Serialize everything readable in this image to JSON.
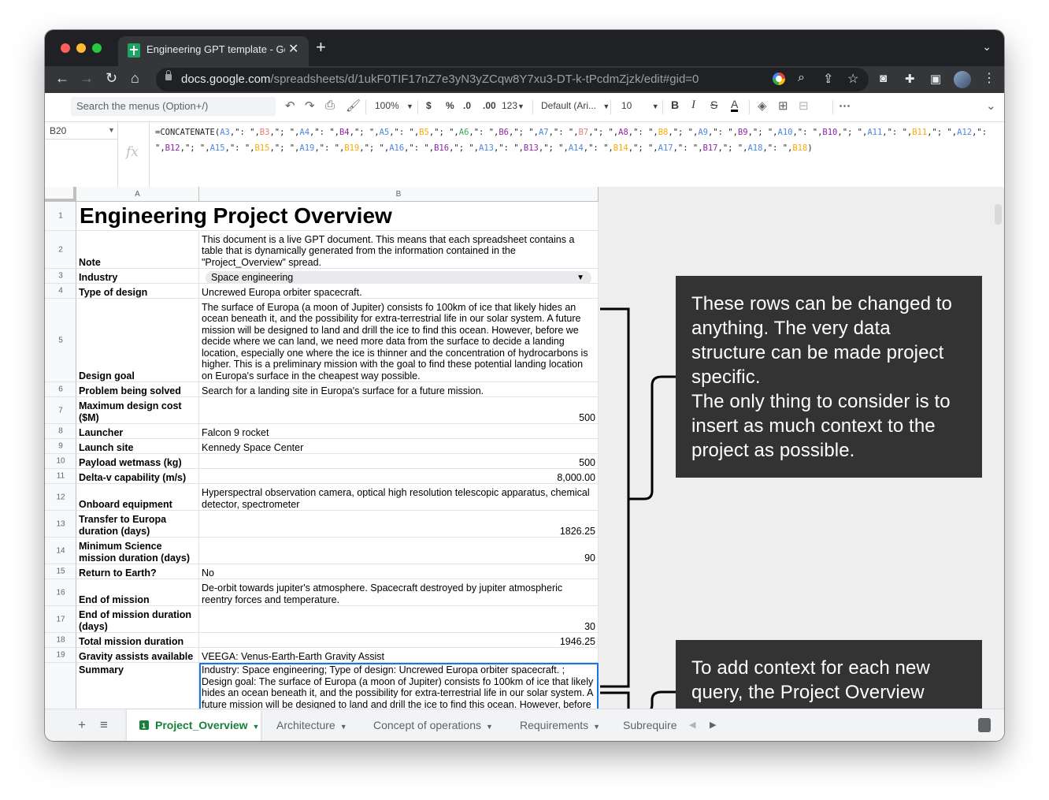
{
  "browser": {
    "tab_title": "Engineering GPT template - Go",
    "url_domain": "docs.google.com",
    "url_path": "/spreadsheets/d/1ukF0TIF17nZ7e3yN3yZCqw8Y7xu3-DT-k-tPcdmZjzk/edit#gid=0",
    "colors": {
      "close": "#ff5f57",
      "minimize": "#febc2e",
      "maximize": "#28c840"
    }
  },
  "sheets_toolbar": {
    "search_placeholder": "Search the menus (Option+/)",
    "zoom": "100%",
    "currency": "$",
    "percent": "%",
    "dec_decrease": ".0",
    "dec_increase": ".00",
    "format_more": "123",
    "font": "Default (Ari...",
    "font_size": "10"
  },
  "formula_bar": {
    "cell_ref": "B20",
    "fx": "fx",
    "segments": [
      [
        "=CONCATENATE(",
        ""
      ],
      [
        "A3",
        "a"
      ],
      [
        ",\": \",",
        ""
      ],
      [
        "B3",
        "b"
      ],
      [
        ",\"; \",",
        ""
      ],
      [
        "A4",
        "a"
      ],
      [
        ",\": \",",
        ""
      ],
      [
        "B4",
        "c"
      ],
      [
        ",\"; \",",
        ""
      ],
      [
        "A5",
        "a"
      ],
      [
        ",\": \",",
        ""
      ],
      [
        "B5",
        "d"
      ],
      [
        ",\"; \",",
        ""
      ],
      [
        "A6",
        "e"
      ],
      [
        ",\": \",",
        ""
      ],
      [
        "B6",
        "c"
      ],
      [
        ",\"; \",",
        ""
      ],
      [
        "A7",
        "a"
      ],
      [
        ",\": \",",
        ""
      ],
      [
        "B7",
        "b"
      ],
      [
        ",\"; \",",
        ""
      ],
      [
        "A8",
        "c"
      ],
      [
        ",\": \",",
        ""
      ],
      [
        "B8",
        "d"
      ],
      [
        ",\"; \",",
        ""
      ],
      [
        "A9",
        "a"
      ],
      [
        ",\": \",",
        ""
      ],
      [
        "B9",
        "c"
      ],
      [
        ",\"; \",",
        ""
      ],
      [
        "A10",
        "a"
      ],
      [
        ",\": \",",
        ""
      ],
      [
        "B10",
        "c"
      ],
      [
        ",\"; \",",
        ""
      ],
      [
        "A11",
        "a"
      ],
      [
        ",\": \",",
        ""
      ],
      [
        "B11",
        "d"
      ],
      [
        ",\"; \",",
        ""
      ],
      [
        "A12",
        "a"
      ],
      [
        ",\": \",",
        ""
      ],
      [
        "B12",
        "c"
      ],
      [
        ",\"; \",",
        ""
      ],
      [
        "A15",
        "a"
      ],
      [
        ",\": \",",
        ""
      ],
      [
        "B15",
        "d"
      ],
      [
        ",\"; \",",
        ""
      ],
      [
        "A19",
        "a"
      ],
      [
        ",\": \",",
        ""
      ],
      [
        "B19",
        "d"
      ],
      [
        ",\"; \",",
        ""
      ],
      [
        "A16",
        "a"
      ],
      [
        ",\": \",",
        ""
      ],
      [
        "B16",
        "c"
      ],
      [
        ",\"; \",",
        ""
      ],
      [
        "A13",
        "a"
      ],
      [
        ",\": \",",
        ""
      ],
      [
        "B13",
        "c"
      ],
      [
        ",\"; \",",
        ""
      ],
      [
        "A14",
        "a"
      ],
      [
        ",\": \",",
        ""
      ],
      [
        "B14",
        "d"
      ],
      [
        ",\"; \",",
        ""
      ],
      [
        "A17",
        "a"
      ],
      [
        ",\": \",",
        ""
      ],
      [
        "B17",
        "c"
      ],
      [
        ",\"; \",",
        ""
      ],
      [
        "A18",
        "a"
      ],
      [
        ",\": \",",
        ""
      ],
      [
        "B18",
        "d"
      ],
      [
        ")",
        ""
      ]
    ]
  },
  "columns": [
    "A",
    "B"
  ],
  "rows": [
    {
      "n": "1",
      "a": "",
      "b": "",
      "title": "Engineering Project Overview",
      "h": 37
    },
    {
      "n": "2",
      "a": "Note",
      "b": "This document is a live GPT document. This means that each spreadsheet contains a table that is dynamically generated from the information contained in the \"Project_Overview\" spread.",
      "h": 48
    },
    {
      "n": "3",
      "a": "Industry",
      "b": "Space engineering",
      "dropdown": true,
      "h": 19
    },
    {
      "n": "4",
      "a": "Type of design",
      "b": "Uncrewed Europa orbiter spacecraft.",
      "h": 19
    },
    {
      "n": "5",
      "a": "Design goal",
      "b": "The surface of Europa (a moon of Jupiter) consists fo 100km of ice that likely hides an ocean beneath it, and the possibility for extra-terrestrial life in our solar system. A future mission will be designed to land and drill the ice to find this ocean. However, before we decide where we can land, we need more data from the surface to decide a landing location, especially one where the ice is thinner and the concentration of hydrocarbons is higher. This is a preliminary mission  with the goal to find these potential landing location on Europa's surface in the cheapest way possible.",
      "h": 106
    },
    {
      "n": "6",
      "a": "Problem being solved",
      "b": "Search for a landing site in Europa's surface for a future mission.",
      "h": 19
    },
    {
      "n": "7",
      "a": "Maximum design cost ($M)",
      "b": "500",
      "num": true,
      "h": 34
    },
    {
      "n": "8",
      "a": "Launcher",
      "b": "Falcon 9 rocket",
      "h": 19
    },
    {
      "n": "9",
      "a": "Launch site",
      "b": "Kennedy Space Center",
      "h": 19
    },
    {
      "n": "10",
      "a": "Payload wetmass (kg)",
      "b": "500",
      "num": true,
      "h": 19
    },
    {
      "n": "11",
      "a": "Delta-v capability (m/s)",
      "b": "8,000.00",
      "num": true,
      "h": 19
    },
    {
      "n": "12",
      "a": "Onboard equipment",
      "b": "Hyperspectral observation camera, optical high resolution telescopic apparatus, chemical detector, spectrometer",
      "h": 34
    },
    {
      "n": "13",
      "a": "Transfer to Europa duration (days)",
      "b": "1826.25",
      "num": true,
      "h": 34
    },
    {
      "n": "14",
      "a": "Minimum Science mission duration (days)",
      "b": "90",
      "num": true,
      "h": 34
    },
    {
      "n": "15",
      "a": "Return to Earth?",
      "b": "No",
      "h": 19
    },
    {
      "n": "16",
      "a": "End of mission",
      "b": "De-orbit towards jupiter's atmosphere. Spacecraft destroyed by jupiter atmospheric reentry forces and temperature.",
      "h": 34
    },
    {
      "n": "17",
      "a": "End of mission duration (days)",
      "b": "30",
      "num": true,
      "h": 34
    },
    {
      "n": "18",
      "a": "Total mission duration",
      "b": "1946.25",
      "num": true,
      "h": 19
    },
    {
      "n": "19",
      "a": "Gravity assists available",
      "b": "VEEGA: Venus-Earth-Earth Gravity Assist",
      "h": 19
    },
    {
      "n": "",
      "a": "Summary",
      "b": "Industry: Space engineering; Type of design: Uncrewed Europa orbiter spacecraft. ; Design goal: The surface of Europa (a moon of Jupiter) consists fo 100km of ice that likely hides an ocean beneath it, and the possibility for extra-terrestrial life in our solar system. A future mission will be designed to land and drill the ice to find this ocean. However, before we decide",
      "summary": true,
      "h": 60
    }
  ],
  "annotations": {
    "top": "These rows can be changed to anything. The very data structure can be made project specific.\nThe only thing to consider is to insert as much context to the project as possible.",
    "bottom": "To add context for each new query, the Project Overview page has a cell with a summary."
  },
  "sheet_tabs": [
    "Project_Overview",
    "Architecture",
    "Concept of operations",
    "Requirements",
    "Subrequire"
  ]
}
